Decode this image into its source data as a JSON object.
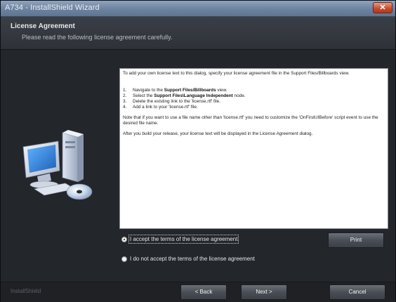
{
  "window": {
    "title": "A734 - InstallShield Wizard",
    "close_glyph": "✕"
  },
  "header": {
    "title": "License Agreement",
    "subtitle": "Please read the following license agreement carefully."
  },
  "license_text": {
    "intro": "To add your own license text to this dialog, specify your license agreement file in the Support Files/Billboards view.",
    "steps": [
      {
        "num": "1.",
        "pre": "Navigate to the ",
        "bold": "Support Files/Billboards",
        "post": " view."
      },
      {
        "num": "2.",
        "pre": "Select the ",
        "bold": "Support Files\\Language Independent",
        "post": " node."
      },
      {
        "num": "3.",
        "pre": "Delete the existing link to the 'license.rtf' file.",
        "bold": "",
        "post": ""
      },
      {
        "num": "4.",
        "pre": "Add a link to your 'license.rtf' file.",
        "bold": "",
        "post": ""
      }
    ],
    "note": "Note that if you want to use a file name other than 'license.rtf' you need to customize the 'OnFirstUIBefore' script event to use the desired file name.",
    "after_build": "After you build your release, your license text will be displayed in the License Agreement dialog."
  },
  "options": {
    "accept_label": "I accept the terms of the license agreement",
    "decline_label": "I do not accept the terms of the license agreement",
    "selected": "accept"
  },
  "buttons": {
    "print": "Print",
    "back": "< Back",
    "next": "Next >",
    "cancel": "Cancel"
  },
  "footer": {
    "brand": "InstallShield"
  },
  "icons": {
    "illustration": "computer-with-cd-icon",
    "app": "installer-icon"
  }
}
